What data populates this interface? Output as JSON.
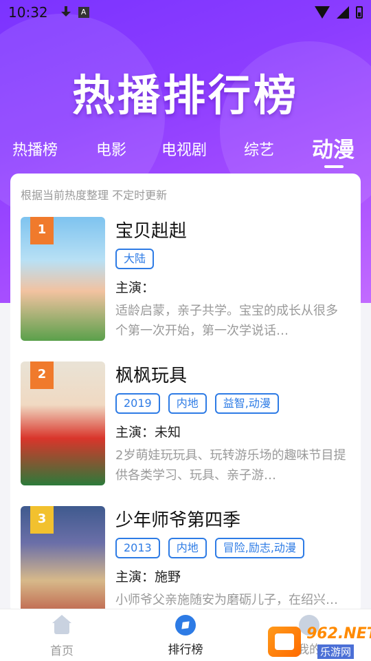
{
  "status_bar": {
    "time": "10:32",
    "a_icon_label": "A"
  },
  "hero": {
    "title": "热播排行榜"
  },
  "tabs": [
    {
      "label": "热播榜",
      "active": false
    },
    {
      "label": "电影",
      "active": false
    },
    {
      "label": "电视剧",
      "active": false
    },
    {
      "label": "综艺",
      "active": false
    },
    {
      "label": "动漫",
      "active": true
    }
  ],
  "list": {
    "note": "根据当前热度整理 不定时更新",
    "items": [
      {
        "rank": "1",
        "rank_color": "#f07a2c",
        "title": "宝贝赳赳",
        "tags": [
          "大陆"
        ],
        "cast": "主演：",
        "desc": "适龄启蒙，亲子共学。宝宝的成长从很多个第一次开始，第一次学说话…",
        "poster_colors": [
          "#7ec3ef",
          "#f2c2a0",
          "#5aa04b"
        ]
      },
      {
        "rank": "2",
        "rank_color": "#f07a2c",
        "title": "枫枫玩具",
        "tags": [
          "2019",
          "内地",
          "益智,动漫"
        ],
        "cast": "主演：未知",
        "desc": "2岁萌娃玩玩具、玩转游乐场的趣味节目提供各类学习、玩具、亲子游…",
        "poster_colors": [
          "#e9e3d6",
          "#d9352b",
          "#2b7a3a"
        ]
      },
      {
        "rank": "3",
        "rank_color": "#f2c12e",
        "title": "少年师爷第四季",
        "tags": [
          "2013",
          "内地",
          "冒险,励志,动漫"
        ],
        "cast": "主演：施野",
        "desc": "小师爷父亲施随安为磨砺儿子，在绍兴…",
        "poster_colors": [
          "#3f5a8e",
          "#d7b98a",
          "#b23a2e"
        ]
      }
    ]
  },
  "bottom_nav": [
    {
      "label": "首页",
      "icon": "home-icon",
      "active": false
    },
    {
      "label": "排行榜",
      "icon": "compass-icon",
      "active": true
    },
    {
      "label": "我的",
      "icon": "profile-icon",
      "active": false
    }
  ],
  "watermark": {
    "line1": "962.NET",
    "line2": "乐游网"
  },
  "colors": {
    "accent": "#2d7be5",
    "hero_start": "#7b33ff",
    "hero_end": "#c26bff"
  }
}
